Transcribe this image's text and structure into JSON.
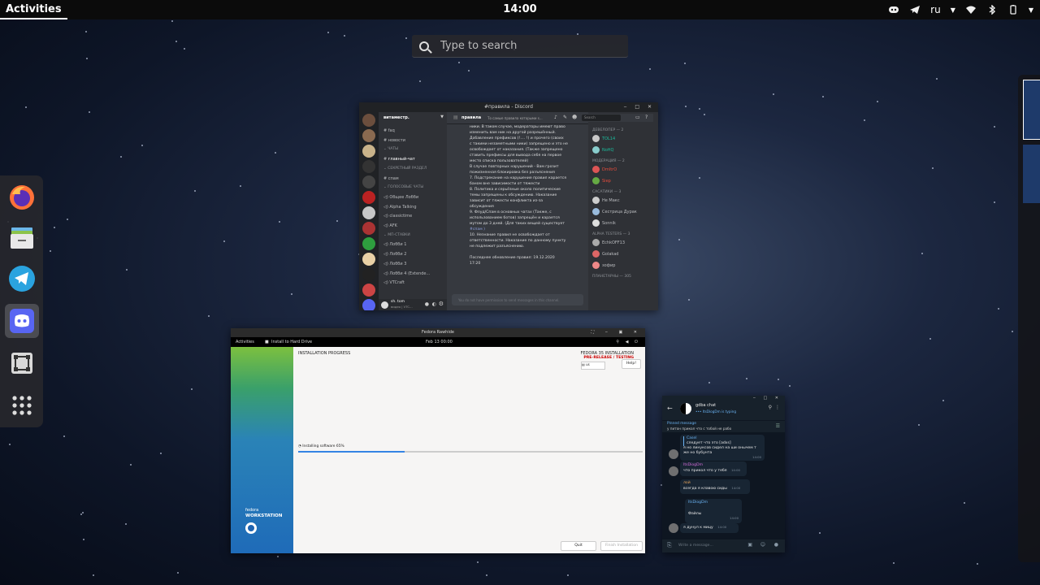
{
  "topbar": {
    "activities": "Activities",
    "clock": "14:00",
    "language": "ru",
    "icons": [
      "discord-icon",
      "telegram-icon",
      "wifi-icon",
      "bluetooth-icon",
      "battery-icon"
    ]
  },
  "search": {
    "placeholder": "Type to search"
  },
  "dash": {
    "apps": [
      "firefox-icon",
      "files-icon",
      "telegram-icon",
      "discord-icon",
      "software-icon",
      "app-grid-icon"
    ],
    "active": "discord-icon"
  },
  "discord": {
    "title": "#правила - Discord",
    "server_name": "витаместр.",
    "channel_title": "правила",
    "channel_topic": "То самые правила которыми s...",
    "search_placeholder": "Search",
    "channels": [
      {
        "label": "faq",
        "type": "text"
      },
      {
        "label": "новости",
        "type": "text"
      },
      {
        "label": "чаты",
        "type": "category"
      },
      {
        "label": "главный-чат",
        "type": "text"
      },
      {
        "label": "секретный раздел",
        "type": "category"
      },
      {
        "label": "спам",
        "type": "text"
      },
      {
        "label": "голосовые чаты",
        "type": "category"
      },
      {
        "label": "Общее Лобби",
        "type": "voice"
      },
      {
        "label": "Alpha Talking",
        "type": "voice"
      },
      {
        "label": "classictime",
        "type": "voice"
      },
      {
        "label": "AFK",
        "type": "voice"
      },
      {
        "label": "мп-ставки",
        "type": "category"
      },
      {
        "label": "Лобби 1",
        "type": "voice"
      },
      {
        "label": "Лобби 2",
        "type": "voice"
      },
      {
        "label": "Лобби 3",
        "type": "voice"
      },
      {
        "label": "Лобби 4 (Extende...",
        "type": "voice"
      },
      {
        "label": "VTCraft",
        "type": "voice"
      }
    ],
    "user": {
      "name": "sh. tom",
      "tag": "видео | VTC..."
    },
    "messages": [
      "ники. В таком случае, модераторы имеют право",
      "изменить вам ник на другой разрешённый.",
      "Добавление префиксов (!.... !) и прочего (своих",
      "с такими незаметными ники) запрещено и это не",
      "освобождает от наказания. (Также запрещено",
      "ставить префиксы для вывода себя на первое",
      "место списка пользователей)",
      "В случае повторных нарушений - Вам грозит",
      "пожизненная блокировка без разъяснения",
      "7. Подстрекание на нарушение правил карается",
      "баном вне зависимости от тяжести",
      "8. Политика и серьёзные около политические",
      "темы запрещены к обсуждению. Наказание",
      "зависит от тяжести конфликта из-за",
      "обсуждения",
      "9. Флуд/Спам в основных чатах (Также, с",
      "использованием ботов) запрещён и карается",
      "мутом до 3 дней. (Для таких вещей существует",
      "#спам )",
      "10. Незнание правил не освобождает от",
      "ответственности. Наказание по данному пункту",
      "не подлежит разъяснению.",
      "",
      "Последнее обновление правил: 19.12.2020",
      "17:20"
    ],
    "input_placeholder": "You do not have permission to send messages in this channel.",
    "member_groups": [
      {
        "label": "ДЕВЕЛОПЕР — 2",
        "members": [
          "TOL14",
          "NoHQ"
        ]
      },
      {
        "label": "МОДЕРАЦИЯ — 2",
        "members": [
          "DmItrO",
          "Siep"
        ]
      },
      {
        "label": "САСАТИКИ — 3",
        "members": [
          "Не Макс",
          "Сестрица Дурак",
          "Sonnik"
        ]
      },
      {
        "label": "ALPHA TESTERS — 3",
        "members": [
          "EchkOFF13",
          "Golakad",
          "зофир"
        ]
      },
      {
        "label": "ПЛАНЕТАРНЫ — 305",
        "members": []
      }
    ]
  },
  "fedora": {
    "window_title": "Fedora Rawhide",
    "activities": "Activities",
    "app_label": "Install to Hard Drive",
    "clock": "Feb 13 00:00",
    "heading": "INSTALLATION PROGRESS",
    "product": "FEDORA 35 INSTALLATION",
    "prerelease": "PRE-RELEASE / TESTING",
    "keyboard": "us",
    "help_label": "Help!",
    "progress_text": "Installing software 65%",
    "progress": 0.31,
    "brand_line1": "fedora",
    "brand_line2": "WORKSTATION",
    "quit_label": "Quit",
    "finish_label": "Finish Installation"
  },
  "telegram": {
    "chat_title": "gdba chat",
    "status": "••• ItsDiogDm is typing",
    "pinned_label": "Pinned message",
    "pinned_text": "у питон прикол что с тобой не рабо",
    "messages": [
      {
        "author": "Casel",
        "text": "следует что это [adxs]",
        "time": ""
      },
      {
        "author": "",
        "text": "я но линуксов сидел на ши онычем т же но бубунта",
        "time": "14:00"
      },
      {
        "author": "ItsDiogDm",
        "text": "что прикол что у тебя",
        "time": "14:00"
      },
      {
        "author": "лой",
        "text": "всегда я клавою сиды",
        "time": "14:00"
      },
      {
        "author": "ItsDiogDm",
        "text": "Файлы",
        "time": "14:00"
      },
      {
        "author": "",
        "text": "я дунул к мицу",
        "time": "14:00"
      }
    ],
    "input_placeholder": "Write a message..."
  }
}
